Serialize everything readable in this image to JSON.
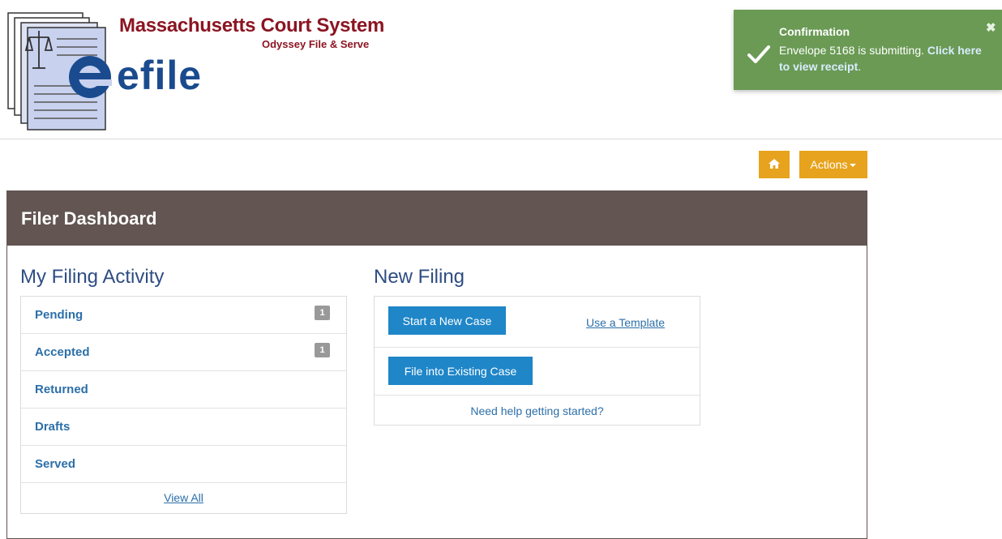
{
  "logo": {
    "title": "Massachusetts Court System",
    "subtitle": "Odyssey File & Serve",
    "brand": "efile"
  },
  "toast": {
    "title": "Confirmation",
    "message": "Envelope 5168 is submitting. ",
    "link": "Click here to view receipt",
    "suffix": ".",
    "close": "✖"
  },
  "toolbar": {
    "actions_label": "Actions"
  },
  "dashboard": {
    "title": "Filer Dashboard"
  },
  "activity": {
    "title": "My Filing Activity",
    "items": [
      {
        "label": "Pending",
        "count": "1"
      },
      {
        "label": "Accepted",
        "count": "1"
      },
      {
        "label": "Returned"
      },
      {
        "label": "Drafts"
      },
      {
        "label": "Served"
      }
    ],
    "view_all": "View All"
  },
  "new_filing": {
    "title": "New Filing",
    "start_case": "Start a New Case",
    "use_template": "Use a Template",
    "file_existing": "File into Existing Case",
    "help": "Need help getting started?"
  },
  "colors": {
    "header_red": "#8b1522",
    "toast_green": "#6a9a54",
    "action_orange": "#e7a31d",
    "panel_brown": "#625552",
    "button_blue": "#1f86c8",
    "link_blue": "#2c6fa9"
  }
}
